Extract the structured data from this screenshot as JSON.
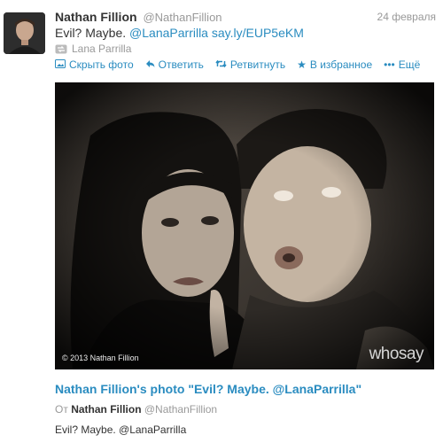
{
  "tweet": {
    "author_name": "Nathan Fillion",
    "author_handle": "@NathanFillion",
    "date": "24 февраля",
    "text": "Evil? Maybe.",
    "mention": "@LanaParrilla",
    "url": "say.ly/EUP5eKM",
    "retweeted_by": "Lana Parrilla"
  },
  "actions": {
    "hide_photo": "Скрыть фото",
    "reply": "Ответить",
    "retweet": "Ретвитнуть",
    "favorite": "В избранное",
    "more": "Ещё"
  },
  "media": {
    "copyright": "© 2013 Nathan Fillion",
    "brand": "whosay"
  },
  "card": {
    "title": "Nathan Fillion's photo \"Evil? Maybe. @LanaParrilla\"",
    "from_label": "От",
    "from_name": "Nathan Fillion",
    "from_handle": "@NathanFillion",
    "description": "Evil? Maybe. @LanaParrilla"
  },
  "colors": {
    "link": "#2a8cc0",
    "muted": "#999999",
    "text": "#333333"
  },
  "icons": [
    "image-icon",
    "reply-icon",
    "retweet-icon",
    "star-icon",
    "more-icon"
  ]
}
